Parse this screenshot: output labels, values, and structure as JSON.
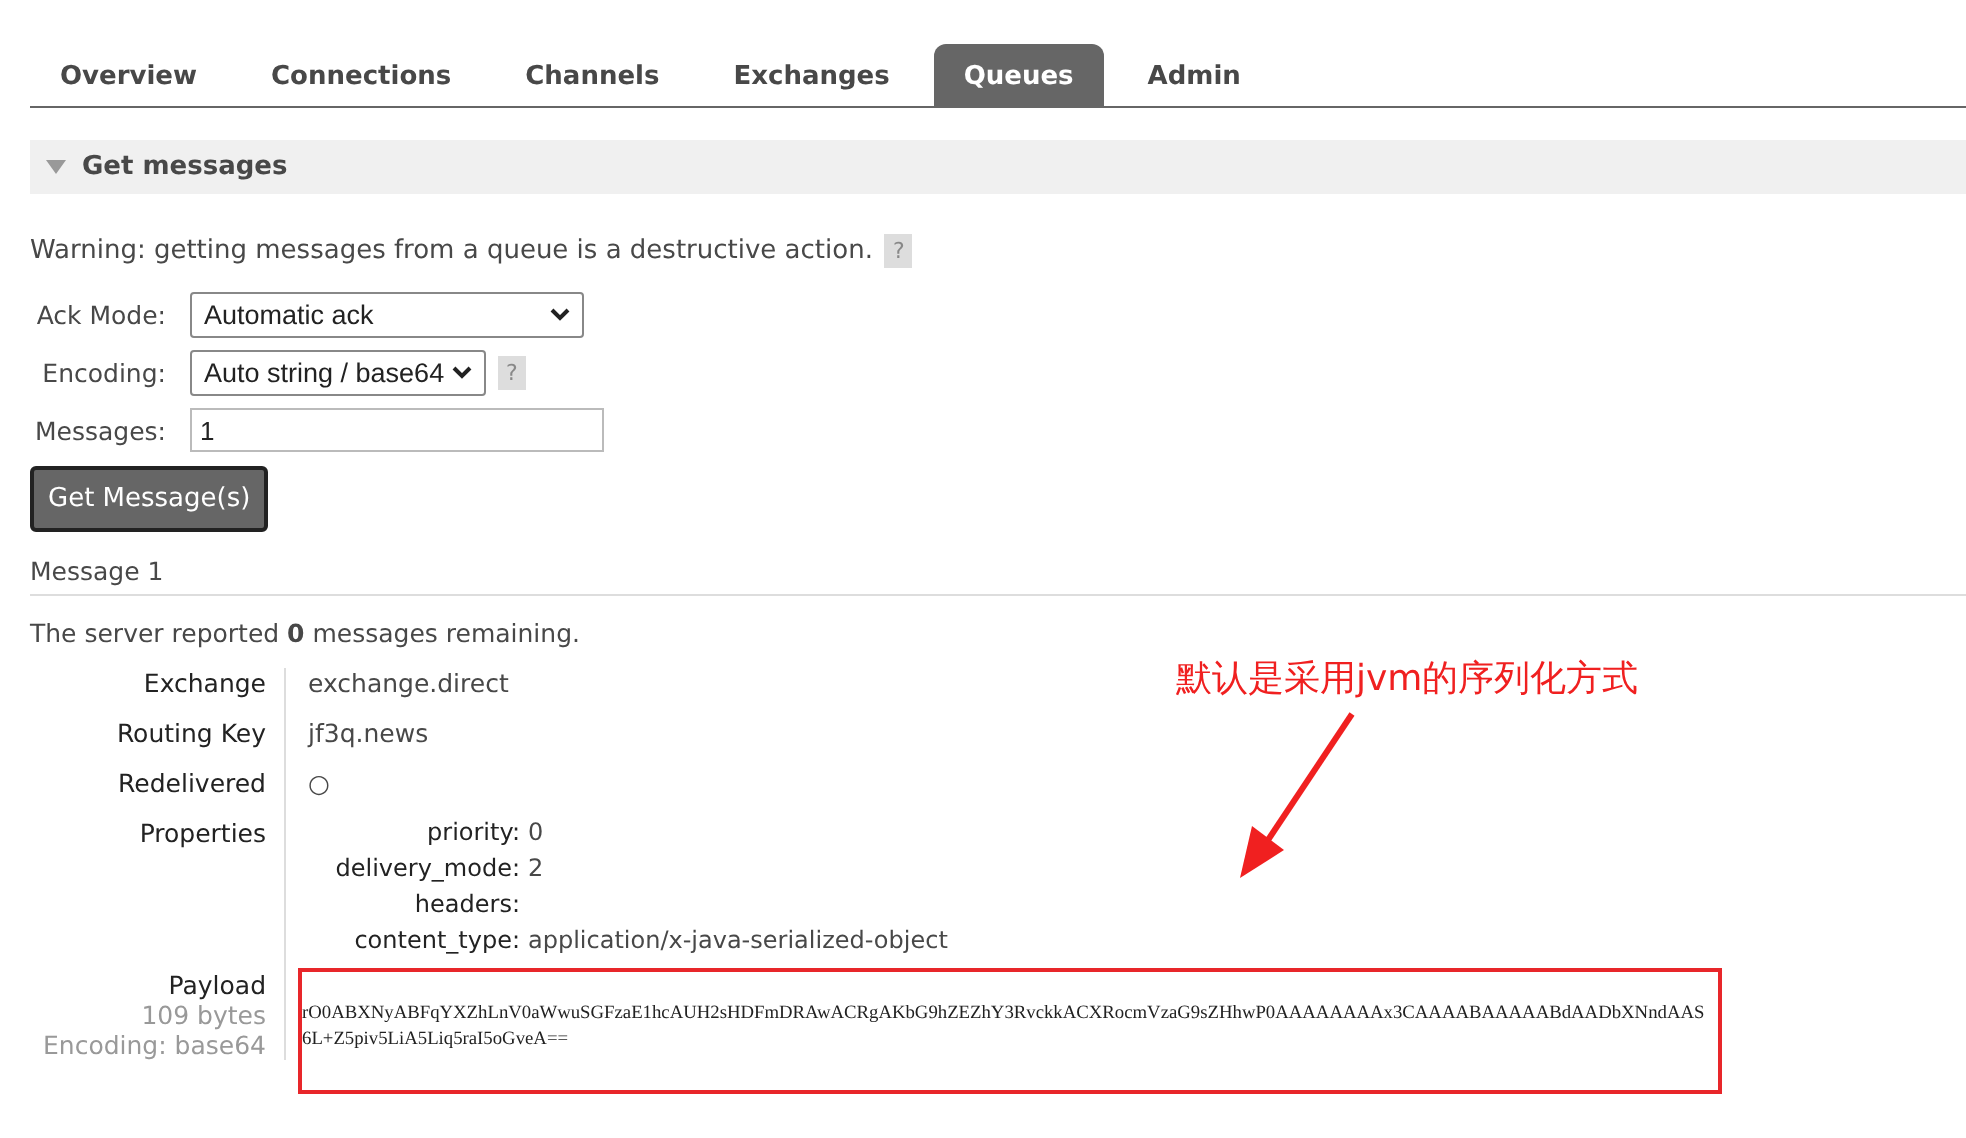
{
  "tabs": [
    {
      "label": "Overview",
      "selected": false
    },
    {
      "label": "Connections",
      "selected": false
    },
    {
      "label": "Channels",
      "selected": false
    },
    {
      "label": "Exchanges",
      "selected": false
    },
    {
      "label": "Queues",
      "selected": true
    },
    {
      "label": "Admin",
      "selected": false
    }
  ],
  "section": {
    "title": "Get messages",
    "expanded": true
  },
  "warning": {
    "text": "Warning: getting messages from a queue is a destructive action.",
    "help": "?"
  },
  "form": {
    "ack_mode": {
      "label": "Ack Mode:",
      "value": "Automatic ack"
    },
    "encoding": {
      "label": "Encoding:",
      "value": "Auto string / base64",
      "help": "?"
    },
    "messages": {
      "label": "Messages:",
      "value": "1"
    },
    "button": "Get Message(s)"
  },
  "message": {
    "heading": "Message 1",
    "remaining": "The server reported **0** messages remaining.",
    "fields": [
      {
        "label": "Exchange",
        "value": "exchange.direct"
      },
      {
        "label": "Routing Key",
        "value": "jf3q.news"
      },
      {
        "label": "Redelivered",
        "value": "○"
      }
    ],
    "properties_label": "Properties",
    "properties": [
      {
        "key": "priority:",
        "value": "0"
      },
      {
        "key": "delivery_mode:",
        "value": "2"
      },
      {
        "key": "headers:"
      },
      {
        "key": "content_type:",
        "value": "application/x-java-serialized-object"
      }
    ],
    "payload": {
      "label": "Payload",
      "size": "109 bytes",
      "encoding": "Encoding: base64",
      "lines": [
        "rO0ABXNyABFqYXZhLnV0aWwuSGFzaE1hcAUH2sHDFmDRAwACRgAKbG9hZEZhY3RvckkACXRocmVzaG9sZHhwP0AAAAAAAAx3CAAAABAAAAABdAADbXNndAAS",
        "6L+Z5piv5LiA5Liq5raI5oGveA=="
      ]
    }
  },
  "annotation": {
    "text": "默认是采用jvm的序列化方式"
  }
}
